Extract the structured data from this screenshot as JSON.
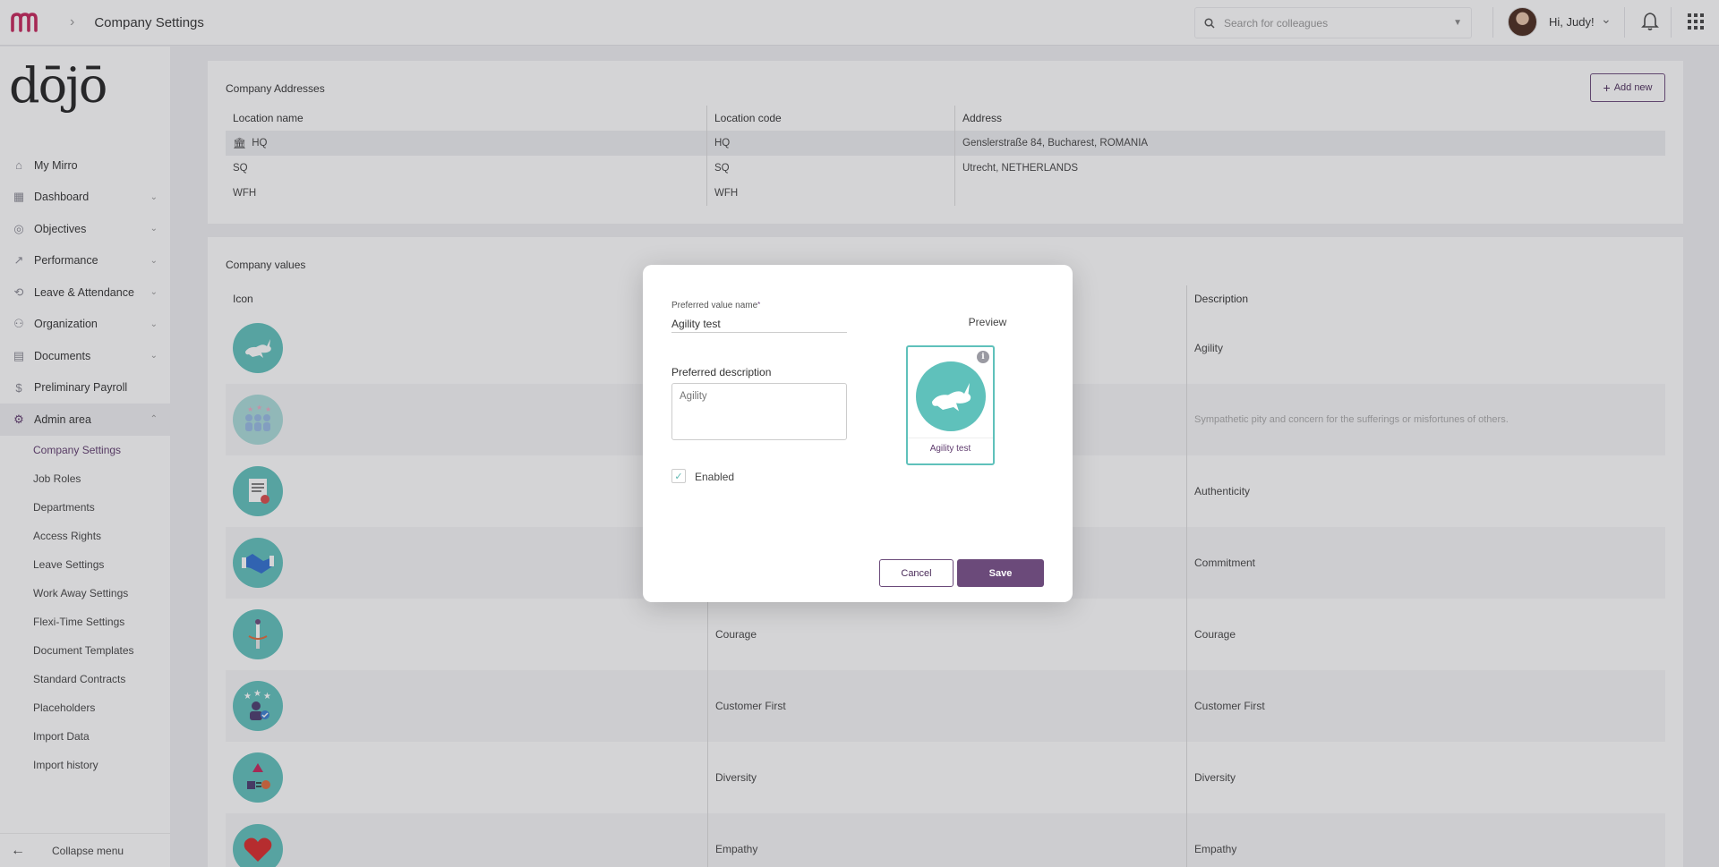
{
  "header": {
    "title": "Company Settings",
    "search_placeholder": "Search for colleagues",
    "greeting": "Hi, Judy!"
  },
  "sidebar": {
    "logo": "dōjō",
    "items": [
      {
        "label": "My Mirro",
        "icon": "home-icon",
        "expandable": false
      },
      {
        "label": "Dashboard",
        "icon": "dashboard-icon",
        "expandable": true
      },
      {
        "label": "Objectives",
        "icon": "target-icon",
        "expandable": true
      },
      {
        "label": "Performance",
        "icon": "trend-icon",
        "expandable": true
      },
      {
        "label": "Leave & Attendance",
        "icon": "history-icon",
        "expandable": true
      },
      {
        "label": "Organization",
        "icon": "people-icon",
        "expandable": true
      },
      {
        "label": "Documents",
        "icon": "document-icon",
        "expandable": true
      },
      {
        "label": "Preliminary Payroll",
        "icon": "dollar-icon",
        "expandable": false
      },
      {
        "label": "Admin area",
        "icon": "gear-icon",
        "expandable": true
      }
    ],
    "subitems": [
      "Company Settings",
      "Job Roles",
      "Departments",
      "Access Rights",
      "Leave Settings",
      "Work Away Settings",
      "Flexi-Time Settings",
      "Document Templates",
      "Standard Contracts",
      "Placeholders",
      "Import Data",
      "Import history"
    ],
    "collapse_label": "Collapse menu"
  },
  "addresses": {
    "title": "Company Addresses",
    "add_label": "Add new",
    "columns": [
      "Location name",
      "Location code",
      "Address"
    ],
    "rows": [
      {
        "name": "HQ",
        "code": "HQ",
        "address": "Genslerstraße 84, Bucharest, ROMANIA"
      },
      {
        "name": "SQ",
        "code": "SQ",
        "address": "Utrecht, NETHERLANDS"
      },
      {
        "name": "WFH",
        "code": "WFH",
        "address": ""
      }
    ]
  },
  "values": {
    "title": "Company values",
    "columns": [
      "Icon",
      "",
      "Description"
    ],
    "rows": [
      {
        "name": "",
        "description": "Agility",
        "icon": "rabbit-icon"
      },
      {
        "name": "",
        "description": "Sympathetic pity and concern for the sufferings or misfortunes of others.",
        "icon": "crowd-icon"
      },
      {
        "name": "",
        "description": "Authenticity",
        "icon": "certificate-icon"
      },
      {
        "name": "",
        "description": "Commitment",
        "icon": "handshake-icon"
      },
      {
        "name": "Courage",
        "description": "Courage",
        "icon": "sword-icon"
      },
      {
        "name": "Customer First",
        "description": "Customer First",
        "icon": "customer-icon"
      },
      {
        "name": "Diversity",
        "description": "Diversity",
        "icon": "shapes-icon"
      },
      {
        "name": "Empathy",
        "description": "Empathy",
        "icon": "heart-hands-icon"
      }
    ]
  },
  "modal": {
    "name_label": "Preferred value name",
    "name_required_mark": "*",
    "name_value": "Agility test",
    "description_label": "Preferred description",
    "description_placeholder": "Agility",
    "enabled_label": "Enabled",
    "enabled_checked": true,
    "preview_label": "Preview",
    "preview_name": "Agility test",
    "cancel_label": "Cancel",
    "save_label": "Save"
  },
  "colors": {
    "accent": "#6b4a7a",
    "teal": "#5fc1bb",
    "brand": "#c4245a"
  }
}
